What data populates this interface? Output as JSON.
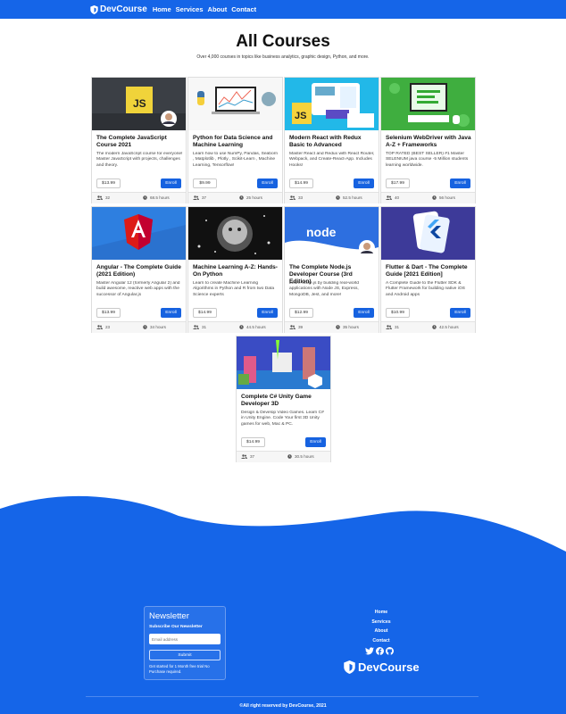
{
  "nav": {
    "brand": "DevCourse",
    "links": [
      "Home",
      "Services",
      "About",
      "Contact"
    ]
  },
  "header": {
    "title": "All Courses",
    "subtitle": "Over 4,000 courses in topics like business analytics, graphic design, Python, and more."
  },
  "enroll_label": "Enroll",
  "courses": [
    {
      "title": "The Complete JavaScript Course 2021",
      "description": "The modern JavaScript course for everyone! Master JavaScript with projects, challenges and theory.",
      "price": "$13.99",
      "students": "32",
      "hours": "68.5 hours",
      "thumbnail": "javascript-thumbnail"
    },
    {
      "title": "Python for Data Science and Machine Learning",
      "description": "Learn how to use NumPy, Pandas, Seaborn , Matplotlib , Plotly , Scikit-Learn , Machine Learning, Tensorflow!",
      "price": "$9.99",
      "students": "37",
      "hours": "25 hours",
      "thumbnail": "python-thumbnail"
    },
    {
      "title": "Modern React with Redux Basic to Advanced",
      "description": "Master React and Redux with React Router, Webpack, and Create-React-App. Includes Hooks!",
      "price": "$14.99",
      "students": "33",
      "hours": "52.5 hours",
      "thumbnail": "react-thumbnail"
    },
    {
      "title": "Selenium WebDriver with Java A-Z + Frameworks",
      "description": "TOP RATED (BEST SELLER) #1 Master SELENIUM java course -5 Million students learning worldwide.",
      "price": "$17.99",
      "students": "40",
      "hours": "56 hours",
      "thumbnail": "selenium-thumbnail"
    },
    {
      "title": "Angular - The Complete Guide (2021 Edition)",
      "description": "Master Angular 12 (formerly Angular 2) and build awesome, reactive web apps with the successor of Angular.js",
      "price": "$13.99",
      "students": "23",
      "hours": "34 hours",
      "thumbnail": "angular-thumbnail"
    },
    {
      "title": "Machine Learning A-Z: Hands-On Python",
      "description": "Learn to create Machine Learning Algorithms in Python and R from two Data Science experts",
      "price": "$14.99",
      "students": "31",
      "hours": "44.5 hours",
      "thumbnail": "machine-learning-thumbnail"
    },
    {
      "title": "The Complete Node.js Developer Course (3rd Edition)",
      "description": "Learn Node.js by building real-world applications with Node JS, Express, MongoDB, Jest, and more!",
      "price": "$12.99",
      "students": "39",
      "hours": "35 hours",
      "thumbnail": "nodejs-thumbnail"
    },
    {
      "title": "Flutter & Dart - The Complete Guide [2021 Edition]",
      "description": "A Complete Guide to the Flutter SDK & Flutter Framework for building native iOS and Android apps",
      "price": "$10.99",
      "students": "31",
      "hours": "42.5 hours",
      "thumbnail": "flutter-thumbnail"
    },
    {
      "title": "Complete C# Unity Game Developer 3D",
      "description": "Design & Develop Video Games. Learn C# in Unity Engine. Code Your first 3D Unity games for web, Mac & PC.",
      "price": "$14.99",
      "students": "37",
      "hours": "30.5 hours",
      "thumbnail": "unity-thumbnail"
    }
  ],
  "newsletter": {
    "title": "Newsletter",
    "subtitle": "Subscribe Our Newsletter",
    "email_placeholder": "Email address",
    "submit_label": "Submit",
    "note": "Get started for 1 Month free trial No Purchase required."
  },
  "footer": {
    "links": [
      "Home",
      "Services",
      "About",
      "Contact"
    ],
    "social_icons": [
      "twitter-icon",
      "facebook-icon",
      "github-icon"
    ],
    "brand": "DevCourse",
    "copyright": "©All right reserved by DevCourse, 2021"
  },
  "colors": {
    "primary": "#1565e8",
    "enroll_button": "#1662e0",
    "card_border": "#dedede"
  }
}
